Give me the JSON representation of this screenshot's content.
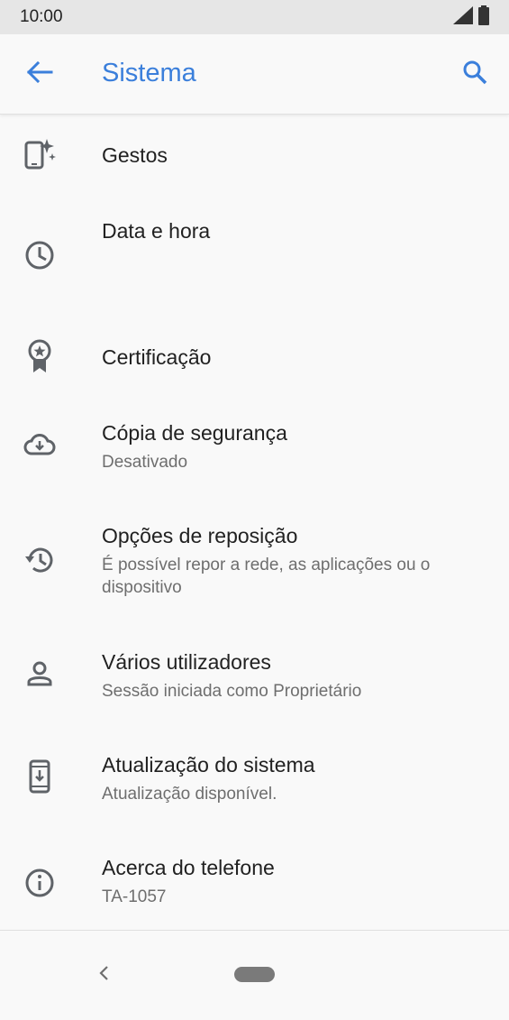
{
  "status_bar": {
    "time": "10:00",
    "icons": [
      "signal-icon",
      "battery-icon"
    ]
  },
  "app_bar": {
    "title": "Sistema",
    "back_icon": "arrow-left-icon",
    "search_icon": "search-icon"
  },
  "colors": {
    "accent": "#3b7fdb",
    "text_primary": "#212121",
    "text_secondary": "#6e6e6e",
    "background": "#f9f9f9"
  },
  "items": [
    {
      "label": "Gestos",
      "summary": "",
      "icon": "gestures-icon"
    },
    {
      "label": "Data e hora",
      "summary": "",
      "icon": "clock-icon"
    },
    {
      "label": "Certificação",
      "summary": "",
      "icon": "certification-icon"
    },
    {
      "label": "Cópia de segurança",
      "summary": "Desativado",
      "icon": "cloud-backup-icon"
    },
    {
      "label": "Opções de reposição",
      "summary": "É possível repor a rede, as aplicações ou o dispositivo",
      "icon": "restore-icon"
    },
    {
      "label": "Vários utilizadores",
      "summary": "Sessão iniciada como Proprietário",
      "icon": "person-icon"
    },
    {
      "label": "Atualização do sistema",
      "summary": "Atualização disponível.",
      "icon": "system-update-icon"
    },
    {
      "label": "Acerca do telefone",
      "summary": "TA-1057",
      "icon": "info-icon"
    }
  ]
}
